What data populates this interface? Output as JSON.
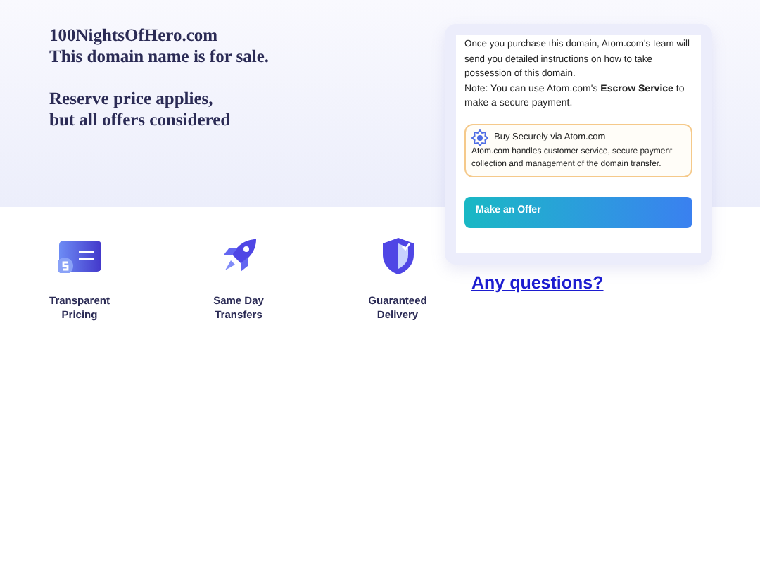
{
  "headline": {
    "domain": "100NightsOfHero.com",
    "sale_text": "This domain name is for sale.",
    "reserve_lines": [
      "Reserve price applies,",
      "but all offers considered"
    ]
  },
  "features": [
    {
      "kind": "pricing",
      "label": "Transparent Pricing"
    },
    {
      "kind": "transfer",
      "label": "Same Day Transfers"
    },
    {
      "kind": "delivery",
      "label": "Guaranteed Delivery"
    }
  ],
  "purchase_card": {
    "info": "Once you purchase this domain, Atom.com's team will send you detailed instructions on how to take possession of this domain.",
    "note": "Note: You can use Atom.com's **Escrow Service** to make a secure payment.",
    "secure_box": {
      "title": "Buy Securely via Atom.com",
      "text": "Atom.com handles customer service, secure payment collection and management of the domain transfer."
    },
    "button": "Make an Offer"
  },
  "questions_link": "Any questions?"
}
